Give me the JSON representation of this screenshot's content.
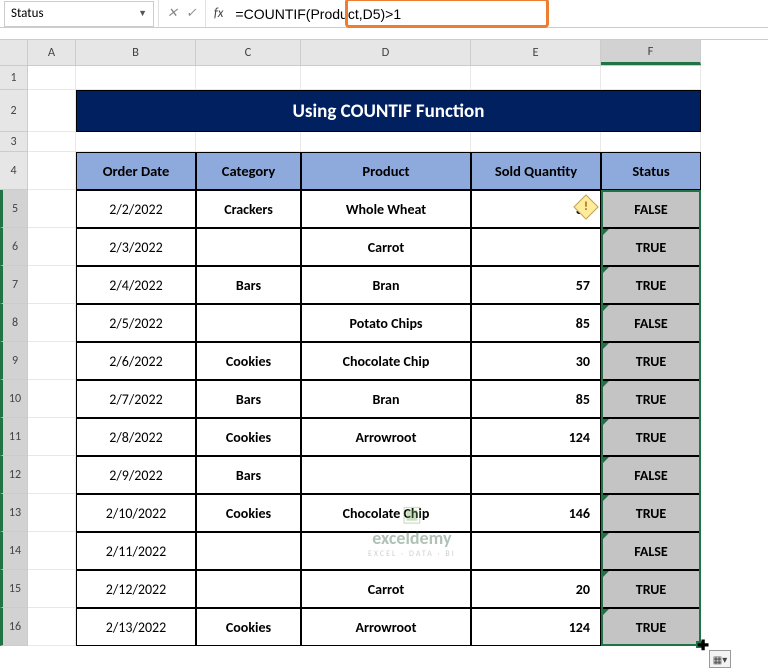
{
  "nameBox": "Status",
  "formula": "=COUNTIF(Product,D5)>1",
  "columns": [
    "A",
    "B",
    "C",
    "D",
    "E",
    "F"
  ],
  "rows": [
    "1",
    "2",
    "3",
    "4",
    "5",
    "6",
    "7",
    "8",
    "9",
    "10",
    "11",
    "12",
    "13",
    "14",
    "15",
    "16"
  ],
  "title": "Using COUNTIF Function",
  "headers": {
    "b": "Order Date",
    "c": "Category",
    "d": "Product",
    "e": "Sold Quantity",
    "f": "Status"
  },
  "data": [
    {
      "date": "2/2/2022",
      "cat": "Crackers",
      "prod": "Whole Wheat",
      "qty": "30",
      "status": "FALSE"
    },
    {
      "date": "2/3/2022",
      "cat": "",
      "prod": "Carrot",
      "qty": "",
      "status": "TRUE"
    },
    {
      "date": "2/4/2022",
      "cat": "Bars",
      "prod": "Bran",
      "qty": "57",
      "status": "TRUE"
    },
    {
      "date": "2/5/2022",
      "cat": "",
      "prod": "Potato Chips",
      "qty": "85",
      "status": "FALSE"
    },
    {
      "date": "2/6/2022",
      "cat": "Cookies",
      "prod": "Chocolate Chip",
      "qty": "30",
      "status": "TRUE"
    },
    {
      "date": "2/7/2022",
      "cat": "Bars",
      "prod": "Bran",
      "qty": "85",
      "status": "TRUE"
    },
    {
      "date": "2/8/2022",
      "cat": "Cookies",
      "prod": "Arrowroot",
      "qty": "124",
      "status": "TRUE"
    },
    {
      "date": "2/9/2022",
      "cat": "Bars",
      "prod": "",
      "qty": "",
      "status": "FALSE"
    },
    {
      "date": "2/10/2022",
      "cat": "Cookies",
      "prod": "Chocolate Chip",
      "qty": "146",
      "status": "TRUE"
    },
    {
      "date": "2/11/2022",
      "cat": "",
      "prod": "",
      "qty": "",
      "status": "FALSE"
    },
    {
      "date": "2/12/2022",
      "cat": "",
      "prod": "Carrot",
      "qty": "20",
      "status": "TRUE"
    },
    {
      "date": "2/13/2022",
      "cat": "Cookies",
      "prod": "Arrowroot",
      "qty": "124",
      "status": "TRUE"
    }
  ],
  "watermark": {
    "brand": "exceldemy",
    "tag": "EXCEL · DATA · BI"
  }
}
